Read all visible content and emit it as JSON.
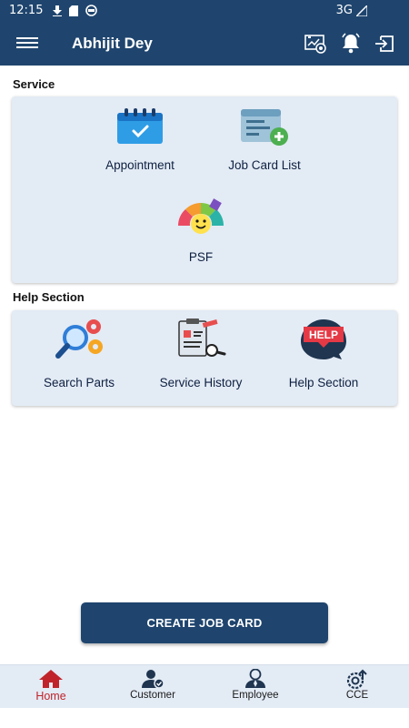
{
  "status": {
    "time": "12:15",
    "network": "3G"
  },
  "app_bar": {
    "title": "Abhijit Dey"
  },
  "service": {
    "label": "Service",
    "items": [
      {
        "label": "Appointment",
        "icon": "calendar-check-icon"
      },
      {
        "label": "Job Card List",
        "icon": "list-add-icon"
      },
      {
        "label": "PSF",
        "icon": "smiley-meter-icon"
      }
    ]
  },
  "help": {
    "label": "Help Section",
    "items": [
      {
        "label": "Search Parts",
        "icon": "search-gears-icon"
      },
      {
        "label": "Service History",
        "icon": "clipboard-magnifier-icon"
      },
      {
        "label": "Help Section",
        "icon": "help-bubble-icon"
      }
    ]
  },
  "create_button": {
    "label": "CREATE JOB CARD"
  },
  "bottom_nav": [
    {
      "label": "Home",
      "icon": "home-icon",
      "active": true
    },
    {
      "label": "Customer",
      "icon": "customer-icon"
    },
    {
      "label": "Employee",
      "icon": "employee-icon"
    },
    {
      "label": "CCE",
      "icon": "cce-icon"
    }
  ],
  "colors": {
    "primary": "#1f456e",
    "card": "#e3ebf5",
    "active_nav": "#c0242a"
  }
}
